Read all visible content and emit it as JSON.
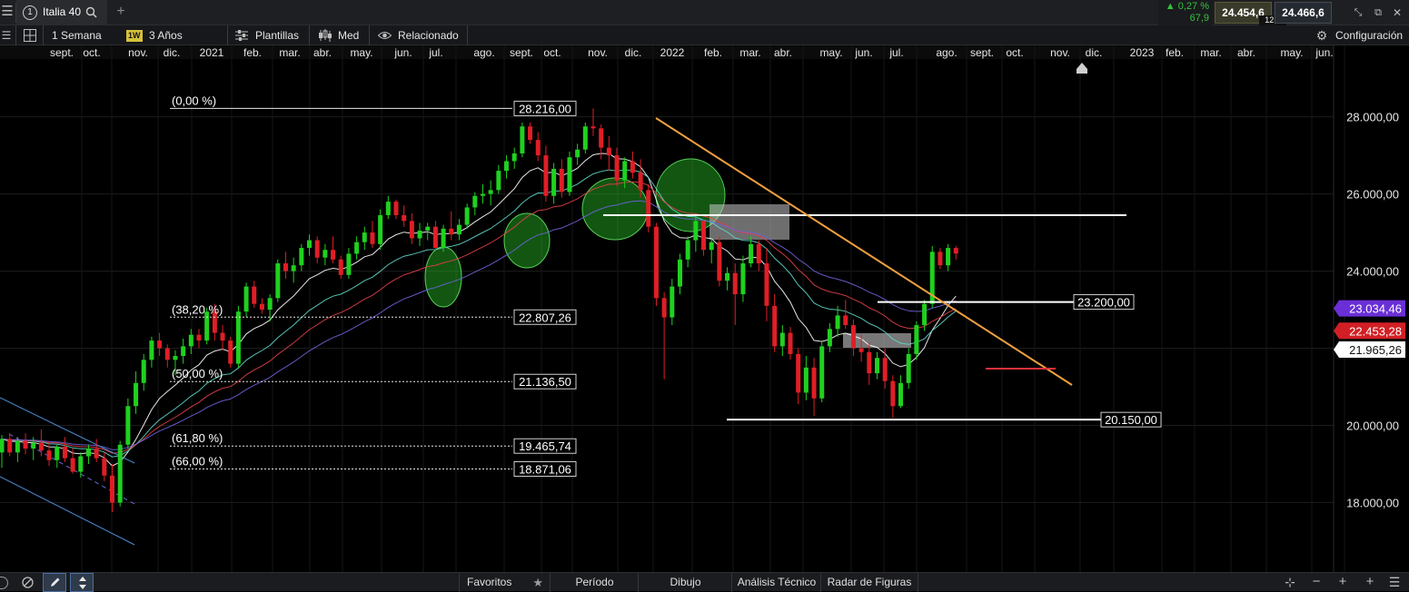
{
  "topbar": {
    "menu_icon": "hamburger-menu-icon",
    "instrument_number": "1",
    "instrument_name": "Italia 40",
    "search_icon": "search-icon",
    "add_tab_icon": "plus-icon",
    "change_pct": "▲ 0,27 %",
    "change_abs": "67,9",
    "bid": "24.454,6",
    "spread": "12,0",
    "ask": "24.466,6",
    "window_icons": [
      "collapse-icon",
      "popout-icon",
      "close-icon"
    ]
  },
  "toolbar": {
    "period_label": "1 Semana",
    "period_badge": "1W",
    "range_label": "3 Años",
    "templates_label": "Plantillas",
    "price_type_label": "Med",
    "related_label": "Relacionado",
    "settings_label": "Configuración"
  },
  "bottombar": {
    "favorites_label": "Favoritos",
    "period_label": "Período",
    "drawing_label": "Dibujo",
    "technical_label": "Análisis Técnico",
    "pattern_label": "Radar de Figuras"
  },
  "chart_data": {
    "type": "candlestick",
    "instrument": "Italia 40",
    "interval": "1W",
    "x_tick_labels": [
      "sept.",
      "oct.",
      "nov.",
      "dic.",
      "2021",
      "feb.",
      "mar.",
      "abr.",
      "may.",
      "jun.",
      "jul.",
      "ago.",
      "sept.",
      "oct.",
      "nov.",
      "dic.",
      "2022",
      "feb.",
      "mar.",
      "abr.",
      "may.",
      "jun.",
      "jul.",
      "ago.",
      "sept.",
      "oct.",
      "nov.",
      "dic.",
      "2023",
      "feb.",
      "mar.",
      "abr.",
      "may.",
      "jun."
    ],
    "y_tick_labels": [
      "28.000,00",
      "26.000,00",
      "24.000,00",
      "22.000,00",
      "20.000,00",
      "18.000,00"
    ],
    "y_ticks": [
      28000,
      26000,
      24000,
      22000,
      20000,
      18000
    ],
    "ylim": [
      16200,
      29850
    ],
    "grid": true,
    "fibonacci": [
      {
        "label": "(0,00 %)",
        "value_label": "28.216,00",
        "value": 28216
      },
      {
        "label": "(38,20 %)",
        "value_label": "22.807,26",
        "value": 22807.26
      },
      {
        "label": "(50,00 %)",
        "value_label": "21.136,50",
        "value": 21136.5
      },
      {
        "label": "(61,80 %)",
        "value_label": "19.465,74",
        "value": 19465.74
      },
      {
        "label": "(66,00 %)",
        "value_label": "18.871,06",
        "value": 18871.06
      }
    ],
    "horizontal_levels": [
      {
        "value": 25450,
        "label": ""
      },
      {
        "value": 23200,
        "label": "23.200,00"
      },
      {
        "value": 20150,
        "label": "20.150,00"
      }
    ],
    "price_badges": [
      {
        "value_label": "23.034,46",
        "value": 23034.46,
        "color": "#6a2fd6"
      },
      {
        "value_label": "22.453,28",
        "value": 22453.28,
        "color": "#d21f25"
      },
      {
        "value_label": "21.965,26",
        "value": 21965.26,
        "color": "#ffffff"
      }
    ],
    "candles": [
      [
        19300,
        19750,
        18900,
        19650
      ],
      [
        19650,
        19800,
        19200,
        19300
      ],
      [
        19300,
        19700,
        19050,
        19600
      ],
      [
        19600,
        19800,
        19250,
        19400
      ],
      [
        19400,
        19700,
        19100,
        19550
      ],
      [
        19550,
        19900,
        19200,
        19350
      ],
      [
        19350,
        19600,
        18950,
        19100
      ],
      [
        19100,
        19500,
        18900,
        19450
      ],
      [
        19450,
        19700,
        19050,
        19150
      ],
      [
        19150,
        19400,
        18750,
        18800
      ],
      [
        18800,
        19300,
        18650,
        19200
      ],
      [
        19200,
        19500,
        19000,
        19400
      ],
      [
        19400,
        19650,
        19050,
        19150
      ],
      [
        19150,
        19300,
        18550,
        18700
      ],
      [
        18700,
        19000,
        17750,
        18000
      ],
      [
        18000,
        19600,
        17900,
        19500
      ],
      [
        19500,
        20700,
        19400,
        20500
      ],
      [
        20500,
        21400,
        20300,
        21100
      ],
      [
        21100,
        21850,
        20900,
        21700
      ],
      [
        21700,
        22300,
        21500,
        22200
      ],
      [
        22200,
        22400,
        21800,
        22000
      ],
      [
        22000,
        22100,
        21500,
        21700
      ],
      [
        21700,
        21950,
        21300,
        21800
      ],
      [
        21800,
        22250,
        21600,
        22050
      ],
      [
        22050,
        22500,
        21850,
        22350
      ],
      [
        22350,
        22500,
        22000,
        22200
      ],
      [
        22200,
        23050,
        22100,
        22950
      ],
      [
        22950,
        23150,
        22200,
        22400
      ],
      [
        22400,
        22600,
        21950,
        22200
      ],
      [
        22200,
        22300,
        21500,
        21600
      ],
      [
        21600,
        23100,
        21500,
        22950
      ],
      [
        22950,
        23700,
        22800,
        23600
      ],
      [
        23600,
        23750,
        23050,
        23150
      ],
      [
        23150,
        23300,
        22900,
        23000
      ],
      [
        23000,
        23400,
        22700,
        23300
      ],
      [
        23300,
        24300,
        23200,
        24200
      ],
      [
        24200,
        24500,
        23800,
        24000
      ],
      [
        24000,
        24350,
        23700,
        24150
      ],
      [
        24150,
        24700,
        24000,
        24600
      ],
      [
        24600,
        24950,
        24400,
        24800
      ],
      [
        24800,
        24900,
        24200,
        24350
      ],
      [
        24350,
        24700,
        24150,
        24550
      ],
      [
        24550,
        24900,
        24200,
        24300
      ],
      [
        24300,
        24400,
        23800,
        23900
      ],
      [
        23900,
        24600,
        23800,
        24450
      ],
      [
        24450,
        24900,
        24300,
        24750
      ],
      [
        24750,
        25150,
        24550,
        25000
      ],
      [
        25000,
        25300,
        24600,
        24700
      ],
      [
        24700,
        25600,
        24550,
        25450
      ],
      [
        25450,
        25950,
        25350,
        25800
      ],
      [
        25800,
        25850,
        25350,
        25450
      ],
      [
        25450,
        25700,
        25150,
        25300
      ],
      [
        25300,
        25500,
        24700,
        24850
      ],
      [
        24850,
        25250,
        24650,
        25050
      ],
      [
        25050,
        25250,
        24800,
        25150
      ],
      [
        25150,
        25300,
        24500,
        24600
      ],
      [
        24600,
        25200,
        24500,
        25100
      ],
      [
        25100,
        25550,
        24800,
        24950
      ],
      [
        24950,
        25350,
        24800,
        25200
      ],
      [
        25200,
        25750,
        25100,
        25650
      ],
      [
        25650,
        26050,
        25450,
        25950
      ],
      [
        25950,
        26250,
        25750,
        26000
      ],
      [
        26000,
        26350,
        25700,
        26100
      ],
      [
        26100,
        26750,
        26000,
        26600
      ],
      [
        26600,
        27000,
        26400,
        26850
      ],
      [
        26850,
        27200,
        26650,
        27050
      ],
      [
        27050,
        27850,
        26950,
        27750
      ],
      [
        27750,
        27850,
        27300,
        27400
      ],
      [
        27400,
        27600,
        26850,
        27000
      ],
      [
        27000,
        27250,
        25800,
        25950
      ],
      [
        25950,
        26800,
        25750,
        26650
      ],
      [
        26650,
        26900,
        25900,
        26050
      ],
      [
        26050,
        27100,
        25950,
        26950
      ],
      [
        26950,
        27300,
        26750,
        27150
      ],
      [
        27150,
        27850,
        27050,
        27750
      ],
      [
        27750,
        28216,
        27500,
        27700
      ],
      [
        27700,
        27800,
        26900,
        27200
      ],
      [
        27200,
        27500,
        26600,
        27000
      ],
      [
        27000,
        27200,
        26200,
        26350
      ],
      [
        26350,
        26950,
        26150,
        26850
      ],
      [
        26850,
        27100,
        26400,
        26550
      ],
      [
        26550,
        26900,
        25900,
        26100
      ],
      [
        26100,
        26250,
        25000,
        25150
      ],
      [
        25150,
        25250,
        23100,
        23300
      ],
      [
        23300,
        23450,
        21200,
        22800
      ],
      [
        22800,
        23800,
        22600,
        23600
      ],
      [
        23600,
        24450,
        23400,
        24300
      ],
      [
        24300,
        24900,
        24100,
        24800
      ],
      [
        24800,
        25450,
        24500,
        25300
      ],
      [
        25300,
        25350,
        24400,
        24550
      ],
      [
        24550,
        24850,
        24200,
        24750
      ],
      [
        24750,
        24900,
        23600,
        23750
      ],
      [
        23750,
        24100,
        23500,
        23950
      ],
      [
        23950,
        24200,
        22600,
        23400
      ],
      [
        23400,
        24400,
        23200,
        24200
      ],
      [
        24200,
        24900,
        24100,
        24700
      ],
      [
        24700,
        24800,
        24000,
        24200
      ],
      [
        24200,
        24600,
        22700,
        23100
      ],
      [
        23100,
        23400,
        21900,
        22050
      ],
      [
        22050,
        22600,
        21800,
        22400
      ],
      [
        22400,
        22550,
        21700,
        21850
      ],
      [
        21850,
        22000,
        20550,
        20850
      ],
      [
        20850,
        21800,
        20650,
        21500
      ],
      [
        21500,
        21750,
        20250,
        20700
      ],
      [
        20700,
        22200,
        20600,
        22050
      ],
      [
        22050,
        22650,
        21900,
        22500
      ],
      [
        22500,
        23100,
        22300,
        22850
      ],
      [
        22850,
        23250,
        22500,
        22600
      ],
      [
        22600,
        22750,
        21800,
        22000
      ],
      [
        22000,
        22350,
        21650,
        21900
      ],
      [
        21900,
        22150,
        21050,
        21350
      ],
      [
        21350,
        21900,
        21200,
        21750
      ],
      [
        21750,
        22000,
        20950,
        21150
      ],
      [
        21150,
        21300,
        20200,
        20500
      ],
      [
        20500,
        21300,
        20450,
        21100
      ],
      [
        21100,
        22000,
        20950,
        21850
      ],
      [
        21850,
        22700,
        21700,
        22600
      ],
      [
        22600,
        23250,
        22450,
        23150
      ],
      [
        23150,
        24650,
        23050,
        24500
      ],
      [
        24500,
        24600,
        24050,
        24150
      ],
      [
        24150,
        24700,
        24000,
        24600
      ],
      [
        24600,
        24650,
        24300,
        24454.6
      ]
    ]
  }
}
